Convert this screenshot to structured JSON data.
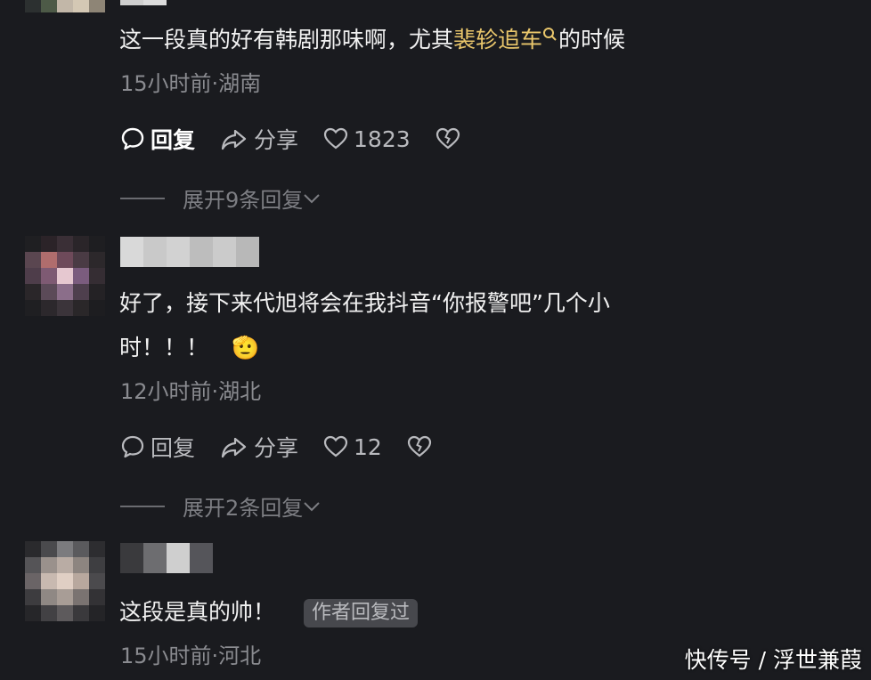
{
  "comments": [
    {
      "text_before": "这一段真的好有韩剧那味啊，尤其",
      "highlight": "裴轸追车",
      "text_after": "的时候",
      "meta": "15小时前·湖南",
      "reply_label": "回复",
      "share_label": "分享",
      "likes": "1823",
      "expand_label": "展开9条回复"
    },
    {
      "line1": "好了，接下来代旭将会在我抖音“你报警吧”几个小",
      "line2": "时！！！",
      "emoji": "🫡",
      "meta": "12小时前·湖北",
      "reply_label": "回复",
      "share_label": "分享",
      "likes": "12",
      "expand_label": "展开2条回复"
    },
    {
      "text": "这段是真的帅！",
      "tag": "作者回复过",
      "meta": "15小时前·河北"
    }
  ],
  "watermark": "快传号 / 浮世兼葭",
  "colors": {
    "background": "#1a1b1f",
    "highlight": "#e9c66b",
    "meta": "#8a8b90"
  }
}
